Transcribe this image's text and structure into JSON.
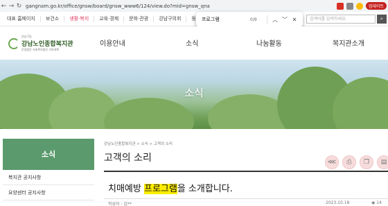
{
  "browser": {
    "url": "gangnam.go.kr/office/gnsw/board/gnsw_www6/124/view.do?mid=gnsw_qna",
    "profile_label": "업데이트"
  },
  "find": {
    "query": "프로그램",
    "count": "0/9"
  },
  "site_top": {
    "links": [
      "대표 홈페이지",
      "보건소",
      "생활·복지",
      "교육·경제",
      "문화·관광",
      "강남구의회",
      "동주민센터"
    ],
    "search_placeholder": "검색어를 입력하세요."
  },
  "logo": {
    "small": "강남구립",
    "name": "강남노인종합복지관",
    "sub": "운영법인 사회복지법인 기아대책"
  },
  "gnb": [
    "이용안내",
    "소식",
    "나눔활동",
    "복지관소개"
  ],
  "hero": {
    "title": "소식"
  },
  "lnb": {
    "title": "소식",
    "items": [
      "복지관 공지사항",
      "요양센터 공지사항"
    ]
  },
  "breadcrumb": "강남노인종합복지관 > 소식 > 고객의 소리",
  "page_title": "고객의 소리",
  "post": {
    "title_before": "치매예방 ",
    "title_highlight": "프로그램",
    "title_after": "을 소개합니다.",
    "author": "작성자 : 김**",
    "date": "2023.10.18",
    "views": "14"
  },
  "colors": {
    "accent_green": "#5a9a6c",
    "highlight": "#ffee00",
    "active_nav": "#e0345a"
  }
}
